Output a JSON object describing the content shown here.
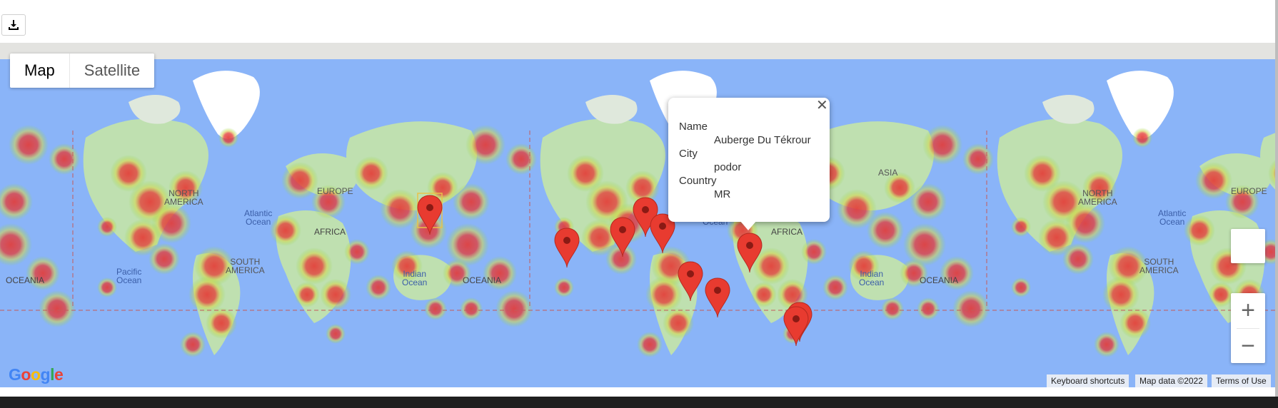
{
  "toolbar": {
    "download_icon": "download-icon"
  },
  "map_type": {
    "map_label": "Map",
    "satellite_label": "Satellite",
    "selected": "Map"
  },
  "map_labels": [
    {
      "text": "NORTH AMERICA",
      "lines": [
        "NORTH",
        "AMERICA"
      ]
    },
    {
      "text": "EUROPE"
    },
    {
      "text": "AFRICA"
    },
    {
      "text": "SOUTH AMERICA",
      "lines": [
        "SOUTH",
        "AMERICA"
      ]
    },
    {
      "text": "ASIA"
    },
    {
      "text": "OCEANIA"
    },
    {
      "text": "Atlantic Ocean",
      "lines": [
        "Atlantic",
        "Ocean"
      ]
    },
    {
      "text": "Indian Ocean",
      "lines": [
        "Indian",
        "Ocean"
      ]
    },
    {
      "text": "Pacific Ocean",
      "lines": [
        "Pacific",
        "Ocean"
      ]
    }
  ],
  "info_window": {
    "name_label": "Name",
    "name_value": "Auberge Du Tékrour",
    "city_label": "City",
    "city_value": "podor",
    "country_label": "Country",
    "country_value": "MR",
    "close_icon": "close-icon"
  },
  "zoom": {
    "in_label": "+",
    "out_label": "−"
  },
  "attribution": {
    "logo": "Google",
    "shortcuts": "Keyboard shortcuts",
    "map_data": "Map data ©2022",
    "terms": "Terms of Use"
  },
  "colors": {
    "ocean": "#8ab4f8",
    "land": "#bfe0b0",
    "heat_red": "#e53935",
    "heat_green": "#8bd74a",
    "marker": "#e83b30"
  }
}
